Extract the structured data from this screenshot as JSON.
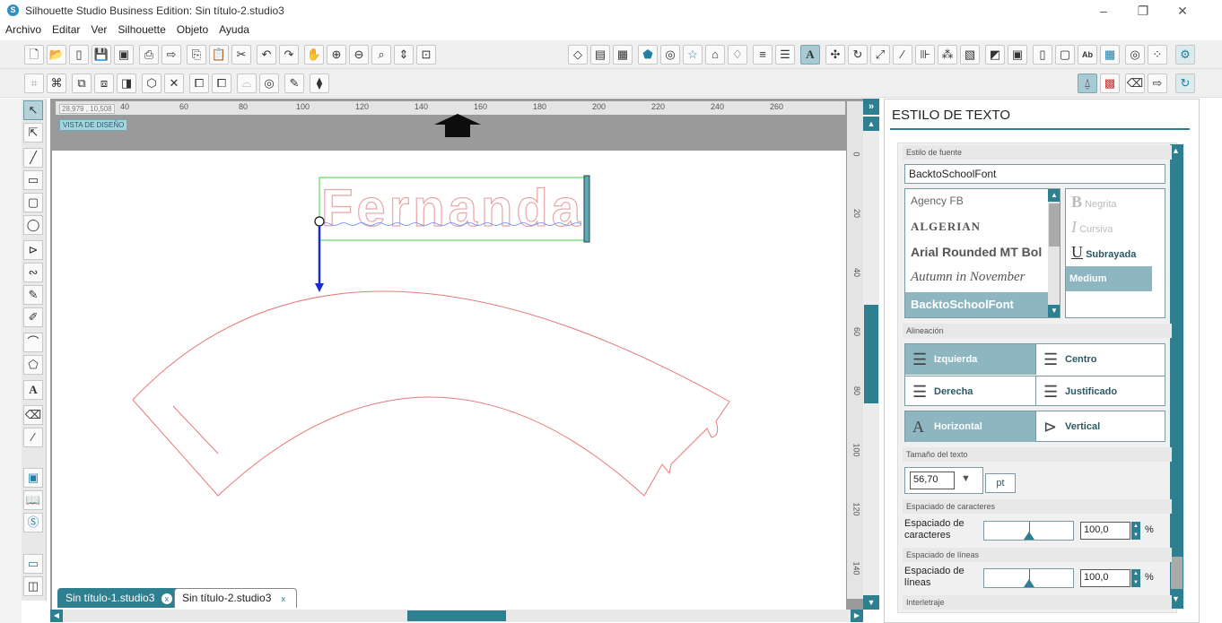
{
  "window": {
    "title": "Silhouette Studio Business Edition: Sin título-2.studio3",
    "min_glyph": "–",
    "max_glyph": "❐",
    "close_glyph": "✕"
  },
  "menu": [
    "Archivo",
    "Editar",
    "Ver",
    "Silhouette",
    "Objeto",
    "Ayuda"
  ],
  "canvas": {
    "coord_readout": "28,979 , 10,508",
    "design_view_label": "VISTA DE DISEÑO",
    "ruler_top": [
      "40",
      "60",
      "80",
      "100",
      "120",
      "140",
      "160",
      "180",
      "200",
      "220",
      "240",
      "260"
    ],
    "ruler_left": [
      "0",
      "20",
      "40",
      "60",
      "80",
      "100",
      "120",
      "140"
    ],
    "text_object": "Fernanda"
  },
  "tabs": [
    {
      "label": "Sin título-1.studio3",
      "active": false
    },
    {
      "label": "Sin título-2.studio3",
      "active": true
    }
  ],
  "panel": {
    "title": "ESTILO DE TEXTO",
    "font_style_section": "Estilo de fuente",
    "font_name_value": "BacktoSchoolFont",
    "fonts": [
      "Agency FB",
      "ALGERIAN",
      "Arial Rounded MT Bol",
      "Autumn in November",
      "BacktoSchoolFont"
    ],
    "selected_font_index": 4,
    "styles": {
      "bold": "Negrita",
      "italic": "Cursiva",
      "underline": "Subrayada",
      "weight": "Medium"
    },
    "alignment_section": "Alineación",
    "alignment": {
      "left": "Izquierda",
      "center": "Centro",
      "right": "Derecha",
      "justify": "Justificado",
      "horizontal": "Horizontal",
      "vertical": "Vertical"
    },
    "text_size_section": "Tamaño del texto",
    "text_size_value": "56,70",
    "text_size_unit": "pt",
    "char_spacing_section": "Espaciado de caracteres",
    "char_spacing_label_1": "Espaciado de",
    "char_spacing_label_2": "caracteres",
    "char_spacing_value": "100,0",
    "line_spacing_section": "Espaciado de líneas",
    "line_spacing_label_1": "Espaciado de",
    "line_spacing_label_2": "líneas",
    "line_spacing_value": "100,0",
    "percent": "%",
    "kerning_section": "Interletraje"
  },
  "colors": {
    "accent": "#2e7f8f",
    "selection": "#8db6c0",
    "cut_line": "#e87a7a",
    "bounding_box": "#3fd13f"
  }
}
